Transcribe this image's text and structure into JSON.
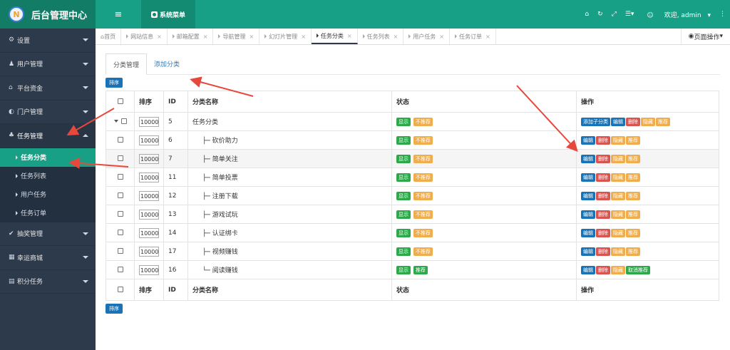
{
  "app": {
    "logo_text": "后台管理中心",
    "logo_letter": "N",
    "sys_menu": "系统菜单",
    "menu_icon": "≡",
    "welcome": "欢迎, admin",
    "top_icons": [
      "home-icon",
      "refresh-icon",
      "fullscreen-icon",
      "list-icon"
    ]
  },
  "sidebar": {
    "items": [
      {
        "label": "设置",
        "icon": "gear-icon"
      },
      {
        "label": "用户管理",
        "icon": "users-icon"
      },
      {
        "label": "平台资金",
        "icon": "bank-icon"
      },
      {
        "label": "门户管理",
        "icon": "globe-icon"
      },
      {
        "label": "任务管理",
        "icon": "sitemap-icon"
      }
    ],
    "sub": [
      "任务分类",
      "任务列表",
      "用户任务",
      "任务订单"
    ],
    "items_after": [
      {
        "label": "抽奖管理",
        "icon": "check-icon"
      },
      {
        "label": "幸运商城",
        "icon": "store-icon"
      },
      {
        "label": "积分任务",
        "icon": "grid-icon"
      }
    ]
  },
  "tabs": [
    {
      "label": "首页"
    },
    {
      "label": "网站信息"
    },
    {
      "label": "邮箱配置"
    },
    {
      "label": "导航管理"
    },
    {
      "label": "幻灯片管理"
    },
    {
      "label": "任务分类"
    },
    {
      "label": "任务列表"
    },
    {
      "label": "用户任务"
    },
    {
      "label": "任务订单"
    }
  ],
  "page_ops": "页面操作",
  "subtabs": [
    "分类管理",
    "添加分类"
  ],
  "sort_btn": "排序",
  "table": {
    "headers": [
      "排序",
      "ID",
      "分类名称",
      "状态",
      "操作"
    ],
    "rows": [
      {
        "order": "10000",
        "id": "5",
        "name": "任务分类",
        "prefix": "",
        "s1": "显示",
        "s2": "不推荐",
        "s2c": "o",
        "actions": [
          "添加子分类",
          "编辑",
          "删除",
          "隐藏",
          "推荐"
        ],
        "parent": true
      },
      {
        "order": "10000",
        "id": "6",
        "name": "砍价助力",
        "prefix": "├─",
        "s1": "显示",
        "s2": "不推荐",
        "s2c": "o",
        "actions": [
          "编辑",
          "删除",
          "隐藏",
          "推荐"
        ]
      },
      {
        "order": "10000",
        "id": "7",
        "name": "简单关注",
        "prefix": "├─",
        "s1": "显示",
        "s2": "不推荐",
        "s2c": "o",
        "actions": [
          "编辑",
          "删除",
          "隐藏",
          "推荐"
        ],
        "hl": true
      },
      {
        "order": "10000",
        "id": "11",
        "name": "简单投票",
        "prefix": "├─",
        "s1": "显示",
        "s2": "不推荐",
        "s2c": "o",
        "actions": [
          "编辑",
          "删除",
          "隐藏",
          "推荐"
        ]
      },
      {
        "order": "10000",
        "id": "12",
        "name": "注册下载",
        "prefix": "├─",
        "s1": "显示",
        "s2": "不推荐",
        "s2c": "o",
        "actions": [
          "编辑",
          "删除",
          "隐藏",
          "推荐"
        ]
      },
      {
        "order": "10000",
        "id": "13",
        "name": "游戏试玩",
        "prefix": "├─",
        "s1": "显示",
        "s2": "不推荐",
        "s2c": "o",
        "actions": [
          "编辑",
          "删除",
          "隐藏",
          "推荐"
        ]
      },
      {
        "order": "10000",
        "id": "14",
        "name": "认证绑卡",
        "prefix": "├─",
        "s1": "显示",
        "s2": "不推荐",
        "s2c": "o",
        "actions": [
          "编辑",
          "删除",
          "隐藏",
          "推荐"
        ]
      },
      {
        "order": "10000",
        "id": "17",
        "name": "视频赚钱",
        "prefix": "├─",
        "s1": "显示",
        "s2": "不推荐",
        "s2c": "o",
        "actions": [
          "编辑",
          "删除",
          "隐藏",
          "推荐"
        ]
      },
      {
        "order": "10000",
        "id": "16",
        "name": "阅读赚钱",
        "prefix": "└─",
        "s1": "显示",
        "s2": "推荐",
        "s2c": "g",
        "actions": [
          "编辑",
          "删除",
          "隐藏",
          "取消推荐"
        ]
      }
    ]
  },
  "colors": {
    "brand": "#17a085",
    "sidebar": "#2d3a4b",
    "active": "#17a085"
  }
}
